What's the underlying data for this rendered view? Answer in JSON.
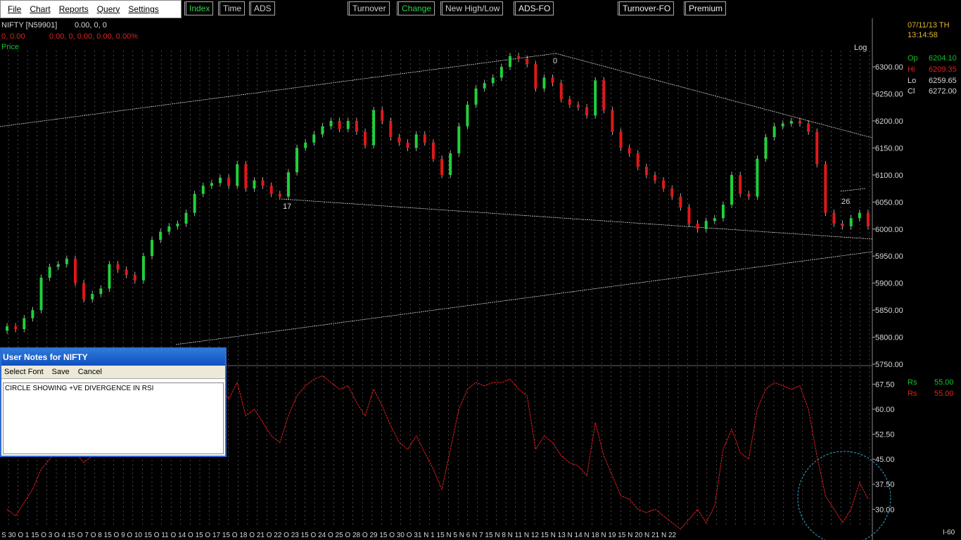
{
  "menu": [
    "File",
    "Chart",
    "Reports",
    "Query",
    "Settings"
  ],
  "toolbar": [
    "Index",
    "Time",
    "ADS",
    "Turnover",
    "Change",
    "New High/Low",
    "ADS-FO",
    "Turnover-FO",
    "Premium"
  ],
  "header": {
    "symbol": "NIFTY [N59901]",
    "values_line1": "0.00,  0,  0",
    "values_line2a": "0,  0.00",
    "values_line2b": "0.00,  0,  0.00,  0.00, 0.00%",
    "panel_label": "Price",
    "scale_label": "Log"
  },
  "datetime": {
    "date": "07/11/13 TH",
    "time": "13:14:58"
  },
  "ohlc": {
    "op_label": "Op",
    "op": "6204.10",
    "hi_label": "Hi",
    "hi": "6209.35",
    "lo_label": "Lo",
    "lo": "6259.65",
    "cl_label": "Cl",
    "cl": "6272.00"
  },
  "rsi_legend": {
    "label1": "Rs",
    "value1": "55.00",
    "label2": "Rs",
    "value2": "55.00"
  },
  "price_ticks": [
    "6300.00",
    "6250.00",
    "6200.00",
    "6150.00",
    "6100.00",
    "6050.00",
    "6000.00",
    "5950.00",
    "5900.00",
    "5850.00",
    "5800.00",
    "5750.00"
  ],
  "rsi_ticks": [
    "67.50",
    "60.00",
    "52.50",
    "45.00",
    "37.50",
    "30.00"
  ],
  "chart_annotations": [
    "17",
    "0",
    "26"
  ],
  "date_axis": "S 30 O 1  15  O 3  O 4 15  O 7  O 8 15  O 9  O 10 15  O 11  O 14  O 15  O 17 15  O 18  O 21  O 22  O 23 15  O 24  O 25  O 28  O 29 15  O 30  O 31  N 1 15  N 5  N 6  N 7 15  N 8  N 11  N 12 15  N 13  N 14  N 18  N 19 15  N 20  N 21  N 22",
  "bottom_right": "I-60",
  "notes_dialog": {
    "title": "User Notes for NIFTY",
    "menu": [
      "Select Font",
      "Save",
      "Cancel"
    ],
    "text": "CIRCLE SHOWING +VE DIVERGENCE IN RSI"
  },
  "chart_data": {
    "type": "candlestick",
    "price_range": [
      5750,
      6330
    ],
    "rsi_range": [
      25,
      72
    ],
    "closes": [
      5820,
      5815,
      5835,
      5850,
      5910,
      5930,
      5935,
      5945,
      5900,
      5870,
      5880,
      5890,
      5935,
      5925,
      5915,
      5905,
      5950,
      5980,
      5995,
      6005,
      6010,
      6030,
      6065,
      6080,
      6085,
      6095,
      6080,
      6120,
      6075,
      6090,
      6080,
      6065,
      6060,
      6105,
      6150,
      6160,
      6175,
      6190,
      6200,
      6185,
      6200,
      6180,
      6155,
      6220,
      6200,
      6170,
      6160,
      6150,
      6175,
      6160,
      6130,
      6100,
      6140,
      6190,
      6230,
      6260,
      6270,
      6280,
      6300,
      6320,
      6315,
      6305,
      6260,
      6280,
      6270,
      6240,
      6230,
      6225,
      6210,
      6275,
      6220,
      6180,
      6150,
      6140,
      6115,
      6100,
      6090,
      6075,
      6060,
      6040,
      6010,
      6000,
      6015,
      6020,
      6045,
      6100,
      6065,
      6060,
      6130,
      6170,
      6190,
      6195,
      6200,
      6195,
      6180,
      6120,
      6030,
      6010,
      6005,
      6020,
      6030,
      6005
    ],
    "rsi": [
      30,
      28,
      32,
      36,
      42,
      45,
      48,
      50,
      47,
      44,
      46,
      48,
      55,
      52,
      50,
      49,
      56,
      60,
      62,
      63,
      61,
      64,
      67,
      66,
      68,
      67,
      63,
      68,
      58,
      60,
      56,
      52,
      50,
      58,
      64,
      67,
      69,
      70,
      68,
      66,
      67,
      62,
      58,
      66,
      61,
      55,
      50,
      48,
      52,
      47,
      42,
      36,
      48,
      60,
      66,
      68,
      67,
      68,
      68,
      69,
      66,
      64,
      48,
      52,
      50,
      46,
      44,
      43,
      40,
      56,
      46,
      40,
      34,
      33,
      30,
      29,
      30,
      28,
      26,
      24,
      27,
      30,
      26,
      31,
      48,
      54,
      47,
      45,
      60,
      66,
      68,
      67,
      66,
      67,
      60,
      46,
      34,
      30,
      26,
      30,
      38,
      33
    ],
    "trendlines_note": "triangle/wedge trendlines drawn on price pane",
    "circle_annotation": "RSI divergence region"
  }
}
